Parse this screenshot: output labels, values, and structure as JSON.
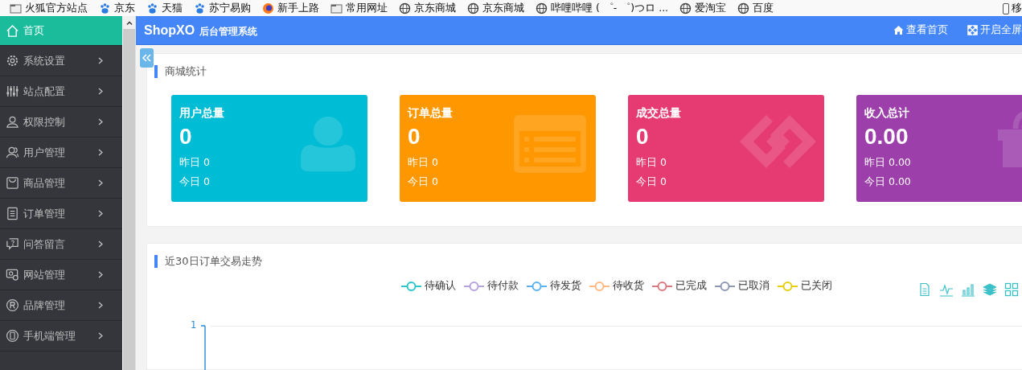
{
  "bookmarks_bar": [
    {
      "kind": "folder",
      "label": "火狐官方站点"
    },
    {
      "kind": "paw",
      "label": "京东"
    },
    {
      "kind": "paw",
      "label": "天猫"
    },
    {
      "kind": "paw",
      "label": "苏宁易购"
    },
    {
      "kind": "fox",
      "label": "新手上路"
    },
    {
      "kind": "folder",
      "label": "常用网址"
    },
    {
      "kind": "globe",
      "label": "京东商城"
    },
    {
      "kind": "globe",
      "label": "京东商城"
    },
    {
      "kind": "globe",
      "label": "哔哩哔哩 ( ゜- ゜)つロ ..."
    },
    {
      "kind": "globe",
      "label": "爱淘宝"
    },
    {
      "kind": "globe",
      "label": "百度"
    }
  ],
  "bookmarks_bar_right": {
    "label": "移"
  },
  "sidebar": {
    "items": [
      {
        "label": "首页",
        "selected": true,
        "has_arrow": false
      },
      {
        "label": "系统设置",
        "selected": false,
        "has_arrow": true
      },
      {
        "label": "站点配置",
        "selected": false,
        "has_arrow": true
      },
      {
        "label": "权限控制",
        "selected": false,
        "has_arrow": true
      },
      {
        "label": "用户管理",
        "selected": false,
        "has_arrow": true
      },
      {
        "label": "商品管理",
        "selected": false,
        "has_arrow": true
      },
      {
        "label": "订单管理",
        "selected": false,
        "has_arrow": true
      },
      {
        "label": "问答留言",
        "selected": false,
        "has_arrow": true
      },
      {
        "label": "网站管理",
        "selected": false,
        "has_arrow": true
      },
      {
        "label": "品牌管理",
        "selected": false,
        "has_arrow": true
      },
      {
        "label": "手机端管理",
        "selected": false,
        "has_arrow": true
      }
    ]
  },
  "header": {
    "logo": "ShopXO",
    "subtitle": "后台管理系统",
    "links": [
      "查看首页",
      "开启全屏"
    ]
  },
  "stats_panel": {
    "title": "商城统计",
    "cards": [
      {
        "title": "用户总量",
        "value": "0",
        "yesterday": "昨日 0",
        "today": "今日 0",
        "color": "#00bcd4"
      },
      {
        "title": "订单总量",
        "value": "0",
        "yesterday": "昨日 0",
        "today": "今日 0",
        "color": "#ff9800"
      },
      {
        "title": "成交总量",
        "value": "0",
        "yesterday": "昨日 0",
        "today": "今日 0",
        "color": "#e63a72"
      },
      {
        "title": "收入总计",
        "value": "0.00",
        "yesterday": "昨日 0.00",
        "today": "今日 0.00",
        "color": "#9c3fab"
      }
    ]
  },
  "chart_panel": {
    "title": "近30日订单交易走势",
    "legend": [
      {
        "label": "待确认",
        "color": "#2ec7c9"
      },
      {
        "label": "待付款",
        "color": "#b6a2de"
      },
      {
        "label": "待发货",
        "color": "#5ab1ef"
      },
      {
        "label": "待收货",
        "color": "#ffb980"
      },
      {
        "label": "已完成",
        "color": "#d87a80"
      },
      {
        "label": "已取消",
        "color": "#8d98b3"
      },
      {
        "label": "已关闭",
        "color": "#e5cf0d"
      }
    ],
    "y_tick_labels": [
      "1"
    ]
  }
}
